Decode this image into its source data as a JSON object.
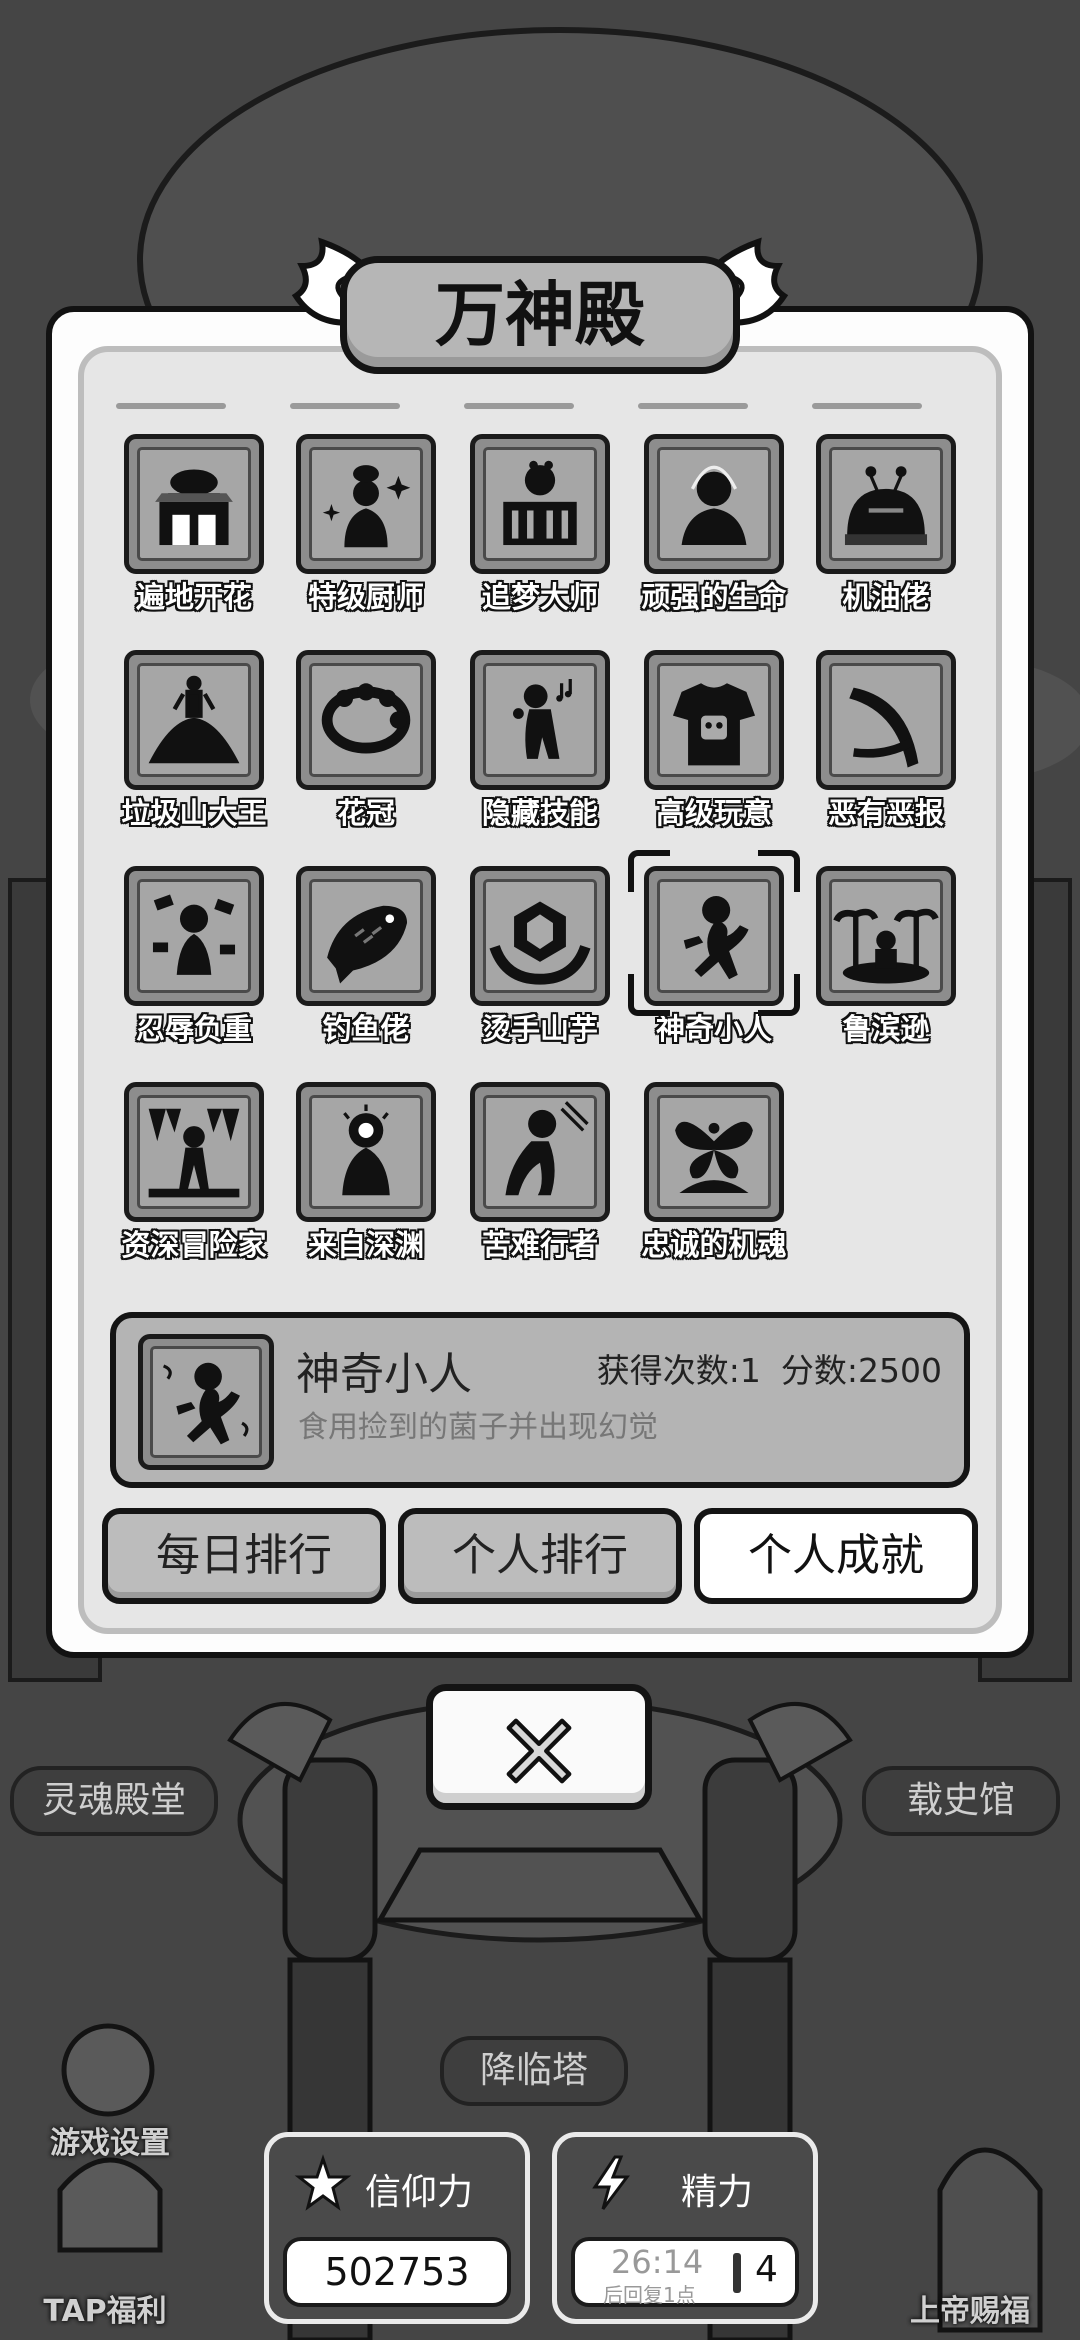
{
  "dialog": {
    "title": "万神殿"
  },
  "achievements": [
    {
      "label": "遍地开花",
      "icon": "burger-shop-icon"
    },
    {
      "label": "特级厨师",
      "icon": "chef-icon"
    },
    {
      "label": "追梦大师",
      "icon": "dream-theater-icon"
    },
    {
      "label": "顽强的生命",
      "icon": "meditating-figure-icon"
    },
    {
      "label": "机油佬",
      "icon": "robot-dome-icon"
    },
    {
      "label": "垃圾山大王",
      "icon": "trash-mountain-king-icon"
    },
    {
      "label": "花冠",
      "icon": "flower-wreath-icon"
    },
    {
      "label": "隐藏技能",
      "icon": "singing-figure-icon"
    },
    {
      "label": "高级玩意",
      "icon": "robot-tshirt-icon"
    },
    {
      "label": "恶有恶报",
      "icon": "boomerang-icon"
    },
    {
      "label": "忍辱负重",
      "icon": "kneeling-figure-icon"
    },
    {
      "label": "钓鱼佬",
      "icon": "fish-icon"
    },
    {
      "label": "烫手山芋",
      "icon": "hands-gem-icon"
    },
    {
      "label": "神奇小人",
      "icon": "dancing-figure-icon",
      "selected": true
    },
    {
      "label": "鲁滨逊",
      "icon": "island-castaway-icon"
    },
    {
      "label": "资深冒险家",
      "icon": "cave-explorer-icon"
    },
    {
      "label": "来自深渊",
      "icon": "abyss-eye-icon"
    },
    {
      "label": "苦难行者",
      "icon": "walker-icon"
    },
    {
      "label": "忠诚的机魂",
      "icon": "fairy-icon"
    }
  ],
  "detail": {
    "name": "神奇小人",
    "obtained": "获得次数:1",
    "score": "分数:2500",
    "description": "食用捡到的菌子并出现幻觉"
  },
  "tabs": {
    "daily": "每日排行",
    "personal": "个人排行",
    "achievements": "个人成就"
  },
  "background": {
    "left_button": "灵魂殿堂",
    "right_button": "载史馆",
    "center_button": "降临塔",
    "settings": "游戏设置",
    "tap": "TAP福利",
    "god_blessing": "上帝赐福"
  },
  "resources": {
    "faith": {
      "label": "信仰力",
      "value": "502753"
    },
    "energy": {
      "label": "精力",
      "timer": "26:14",
      "sub": "后回复1点",
      "count": "4"
    }
  },
  "colors": {
    "dialog_bg": "#fdfdfd",
    "panel_bg": "#e6e6e6",
    "tile_bg": "#8d8d8d",
    "outline": "#141414"
  }
}
